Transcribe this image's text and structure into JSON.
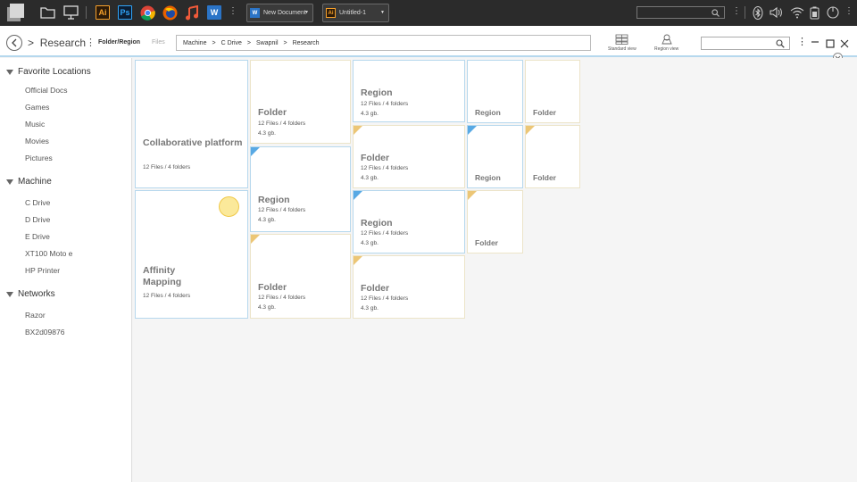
{
  "taskbar": {
    "apps": [
      {
        "name": "illustrator",
        "label": "Ai"
      },
      {
        "name": "photoshop",
        "label": "Ps"
      },
      {
        "name": "word",
        "label": "W"
      }
    ],
    "doc1": {
      "label": "New Document",
      "badge": "W"
    },
    "doc2": {
      "label": "Untitled-1",
      "badge": "Ai"
    }
  },
  "nav": {
    "title": "Research",
    "tab_folder": "Folder/Region",
    "tab_files": "Files",
    "path": [
      "Machine",
      "C Drive",
      "Swapnil",
      "Research"
    ],
    "path_sep": ">",
    "standard_view": "Standard view",
    "region_view": "Region view",
    "title_chevron": ">"
  },
  "sidebar": {
    "favorites": {
      "title": "Favorite Locations",
      "items": [
        "Official Docs",
        "Games",
        "Music",
        "Movies",
        "Pictures"
      ]
    },
    "machine": {
      "title": "Machine",
      "items": [
        "C Drive",
        "D Drive",
        "E Drive",
        "XT100 Moto e",
        "HP Printer"
      ]
    },
    "networks": {
      "title": "Networks",
      "items": [
        "Razor",
        "BX2d09876"
      ]
    }
  },
  "cards": [
    {
      "name": "Collaborative platform",
      "files": "12 Files / 4 folders",
      "size": ""
    },
    {
      "name": "Affinity Mapping",
      "files": "12 Files / 4 folders",
      "size": ""
    },
    {
      "name": "Folder",
      "files": "12 Files / 4 folders",
      "size": "4.3 gb."
    },
    {
      "name": "Region",
      "files": "12 Files / 4 folders",
      "size": "4.3 gb."
    },
    {
      "name": "Folder",
      "files": "12 Files / 4 folders",
      "size": "4.3 gb."
    },
    {
      "name": "Region",
      "files": "12 Files / 4 folders",
      "size": "4.3 gb."
    },
    {
      "name": "Folder",
      "files": "12 Files / 4 folders",
      "size": "4.3 gb."
    },
    {
      "name": "Region",
      "files": "12 Files / 4 folders",
      "size": "4.3 gb."
    },
    {
      "name": "Folder",
      "files": "12 Files / 4 folders",
      "size": "4.3 gb."
    },
    {
      "name": "Region"
    },
    {
      "name": "Region"
    },
    {
      "name": "Folder"
    },
    {
      "name": "Folder"
    },
    {
      "name": "Folder"
    }
  ],
  "colors": {
    "region_accent": "#58a9e4",
    "folder_accent": "#ecc676",
    "taskbar": "#2b2b2b"
  }
}
